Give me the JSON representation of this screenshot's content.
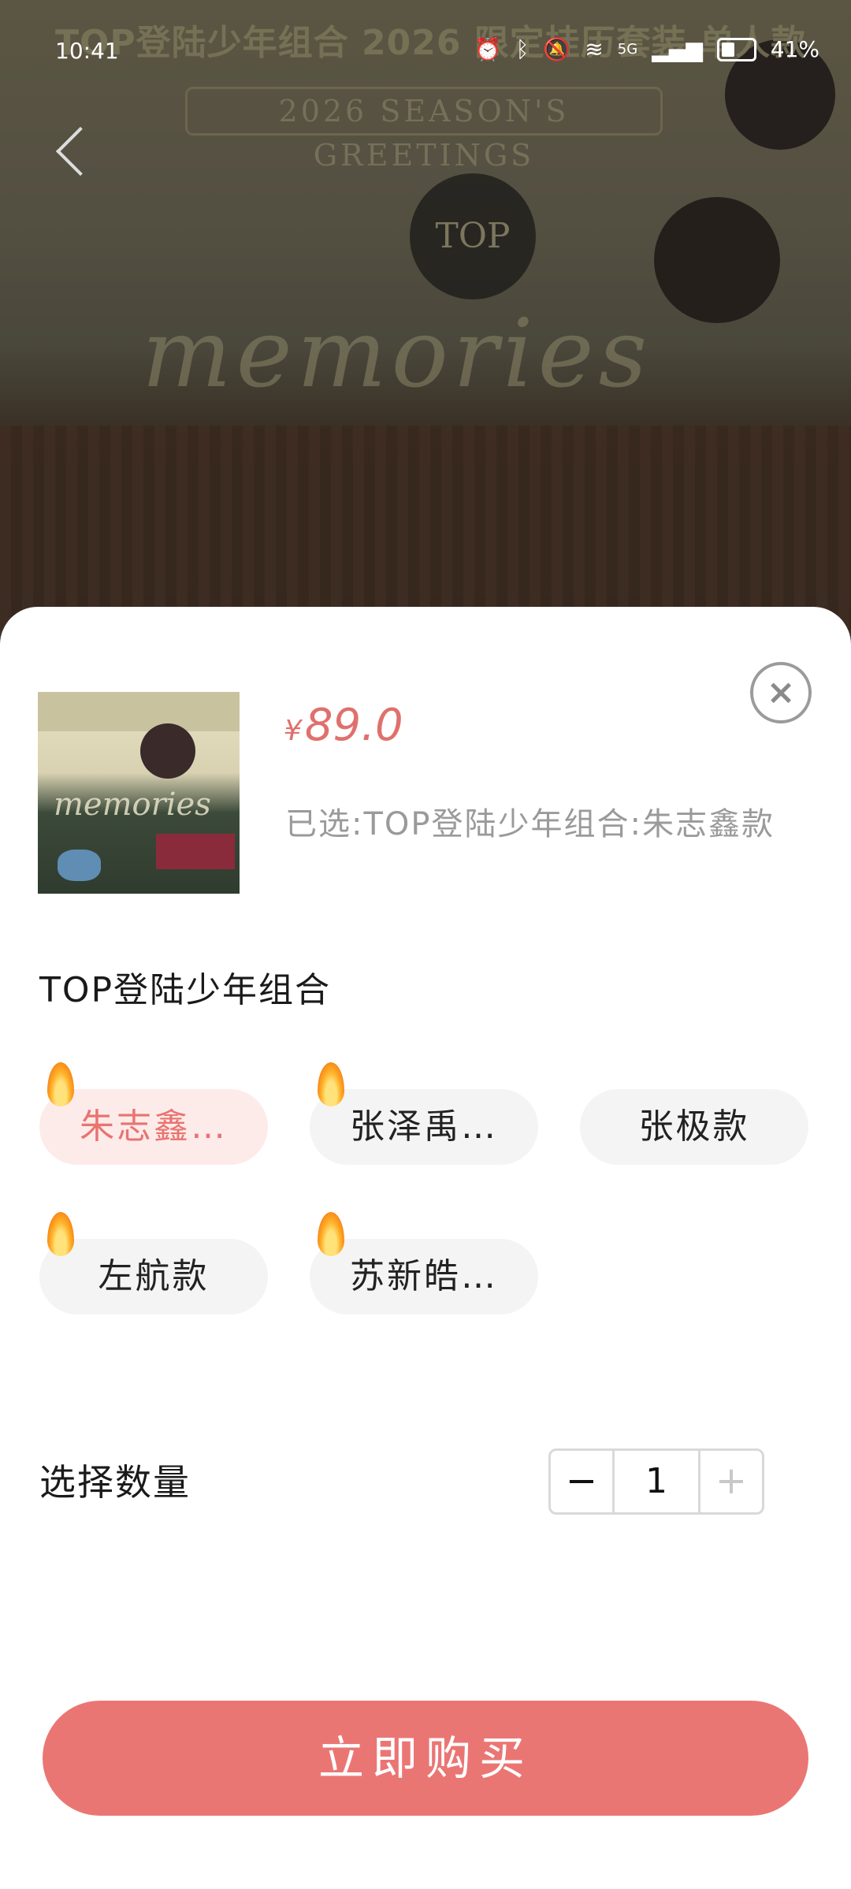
{
  "status_bar": {
    "time": "10:41",
    "network": "5G",
    "battery": "41%"
  },
  "banner": {
    "title": "TOP登陆少年组合 2026 限定挂历套装 单人款",
    "subtitle": "2026 SEASON'S GREETINGS",
    "brand": "TOP",
    "script": "memories"
  },
  "sheet": {
    "price_currency": "¥",
    "price_value": "89.0",
    "selected_text": "已选:TOP登陆少年组合:朱志鑫款",
    "group_title": "TOP登陆少年组合",
    "options": [
      {
        "label": "朱志鑫…",
        "selected": true,
        "hot": true
      },
      {
        "label": "张泽禹…",
        "selected": false,
        "hot": true
      },
      {
        "label": "张极款",
        "selected": false,
        "hot": false
      },
      {
        "label": "左航款",
        "selected": false,
        "hot": true
      },
      {
        "label": "苏新皓…",
        "selected": false,
        "hot": true
      }
    ],
    "quantity_label": "选择数量",
    "quantity_value": "1",
    "minus": "−",
    "plus": "+",
    "buy_label": "立即购买",
    "close_symbol": "×"
  },
  "colors": {
    "accent": "#ea7674",
    "price": "#e0706d",
    "selected_bg": "#fdebea"
  }
}
